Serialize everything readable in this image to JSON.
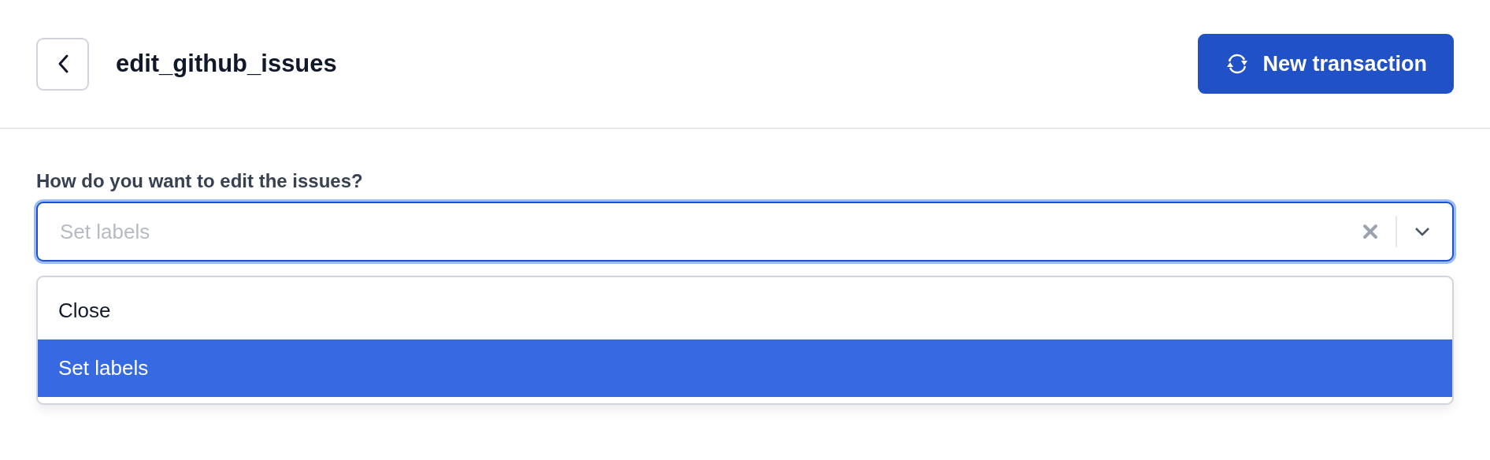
{
  "header": {
    "title": "edit_github_issues",
    "primary_button": "New transaction"
  },
  "question": {
    "label": "How do you want to edit the issues?",
    "placeholder": "Set labels",
    "focused": true,
    "expanded": true
  },
  "options": [
    {
      "label": "Close",
      "selected": false
    },
    {
      "label": "Set labels",
      "selected": true
    }
  ]
}
